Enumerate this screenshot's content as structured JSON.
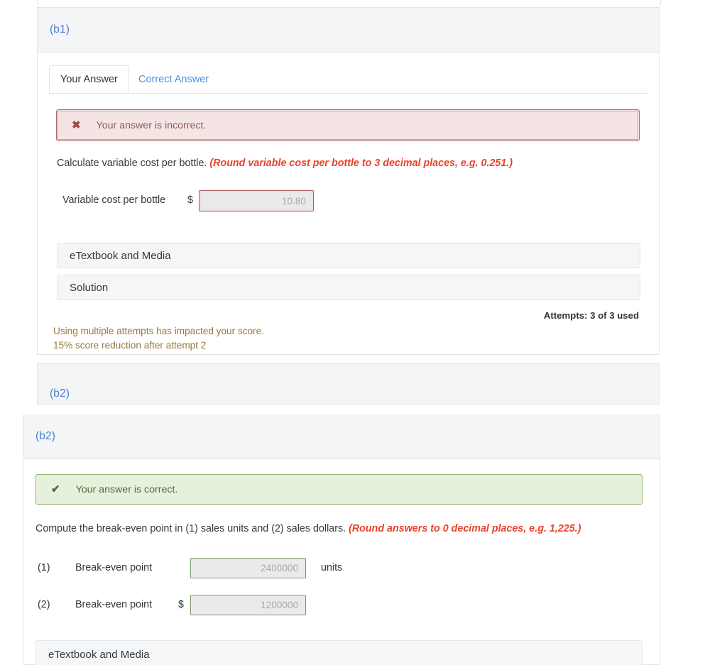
{
  "captures": [
    {
      "id": "capture-b1",
      "part_label": "(b1)",
      "tabs": [
        {
          "label": "Your Answer",
          "active": true
        },
        {
          "label": "Correct Answer",
          "active": false
        }
      ],
      "alert": {
        "type": "error",
        "icon": "x-mark-icon",
        "glyph": "✖",
        "text": "Your answer is incorrect.",
        "bg": "#f4e4e3",
        "border": "#ad6a68",
        "text_color": "#8d5b59"
      },
      "question": {
        "prompt": "Calculate variable cost per bottle.",
        "hint": "(Round variable cost per bottle to 3 decimal places, e.g. 0.251.)",
        "hint_color": "#e8422b"
      },
      "answer_row": {
        "label": "Variable cost per bottle",
        "currency": "$",
        "value": "10.80",
        "state": "incorrect",
        "border_color": "#a85f5d"
      },
      "accordions": [
        {
          "label": "eTextbook and Media"
        },
        {
          "label": "Solution"
        }
      ],
      "attempts": "Attempts: 3 of 3 used",
      "warnings": [
        "Using multiple attempts has impacted your score.",
        "15% score reduction after attempt 2"
      ],
      "warning_color": "#96793f",
      "next_part_label_clipped": "(b2)"
    },
    {
      "id": "capture-b2",
      "part_label": "(b2)",
      "alert": {
        "type": "success",
        "icon": "check-mark-icon",
        "glyph": "✔",
        "text": "Your answer is correct.",
        "bg": "#e6f1dc",
        "border": "#8fb275",
        "text_color": "#4f6b3a"
      },
      "question": {
        "prompt": "Compute the break-even point in (1) sales units and (2) sales dollars.",
        "hint": "(Round answers to 0 decimal places, e.g. 1,225.)",
        "hint_color": "#e8422b"
      },
      "answer_rows": [
        {
          "number": "(1)",
          "label": "Break-even point",
          "currency": "",
          "value": "2400000",
          "unit": "units",
          "state": "correct",
          "border_color": "#7d9a6a"
        },
        {
          "number": "(2)",
          "label": "Break-even point",
          "currency": "$",
          "value": "1200000",
          "unit": "",
          "state": "correct",
          "border_color": "#7d9a6a"
        }
      ],
      "accordions": [
        {
          "label": "eTextbook and Media"
        }
      ]
    }
  ],
  "theme": {
    "part_label_color": "#4a7fd0",
    "link_color": "#4a90e2",
    "card_bg": "#ffffff",
    "card_header_bg": "#f4f5f6",
    "border_color": "#e3e4e6",
    "field_bg": "#e9eaeb",
    "field_text": "#a7a9ab",
    "accordion_bg": "#f5f6f7"
  }
}
